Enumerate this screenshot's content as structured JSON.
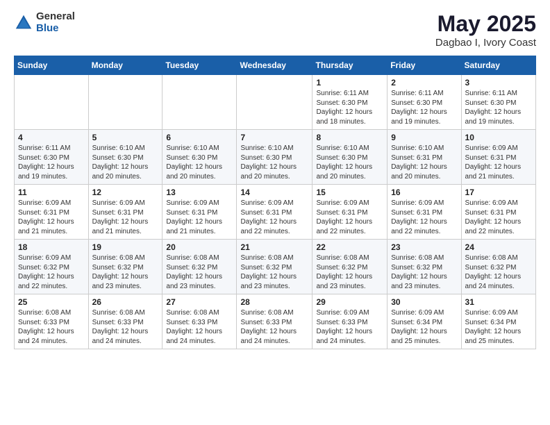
{
  "header": {
    "logo_general": "General",
    "logo_blue": "Blue",
    "month_title": "May 2025",
    "location": "Dagbao I, Ivory Coast"
  },
  "days_of_week": [
    "Sunday",
    "Monday",
    "Tuesday",
    "Wednesday",
    "Thursday",
    "Friday",
    "Saturday"
  ],
  "weeks": [
    [
      {
        "day": "",
        "info": ""
      },
      {
        "day": "",
        "info": ""
      },
      {
        "day": "",
        "info": ""
      },
      {
        "day": "",
        "info": ""
      },
      {
        "day": "1",
        "info": "Sunrise: 6:11 AM\nSunset: 6:30 PM\nDaylight: 12 hours\nand 18 minutes."
      },
      {
        "day": "2",
        "info": "Sunrise: 6:11 AM\nSunset: 6:30 PM\nDaylight: 12 hours\nand 19 minutes."
      },
      {
        "day": "3",
        "info": "Sunrise: 6:11 AM\nSunset: 6:30 PM\nDaylight: 12 hours\nand 19 minutes."
      }
    ],
    [
      {
        "day": "4",
        "info": "Sunrise: 6:11 AM\nSunset: 6:30 PM\nDaylight: 12 hours\nand 19 minutes."
      },
      {
        "day": "5",
        "info": "Sunrise: 6:10 AM\nSunset: 6:30 PM\nDaylight: 12 hours\nand 20 minutes."
      },
      {
        "day": "6",
        "info": "Sunrise: 6:10 AM\nSunset: 6:30 PM\nDaylight: 12 hours\nand 20 minutes."
      },
      {
        "day": "7",
        "info": "Sunrise: 6:10 AM\nSunset: 6:30 PM\nDaylight: 12 hours\nand 20 minutes."
      },
      {
        "day": "8",
        "info": "Sunrise: 6:10 AM\nSunset: 6:30 PM\nDaylight: 12 hours\nand 20 minutes."
      },
      {
        "day": "9",
        "info": "Sunrise: 6:10 AM\nSunset: 6:31 PM\nDaylight: 12 hours\nand 20 minutes."
      },
      {
        "day": "10",
        "info": "Sunrise: 6:09 AM\nSunset: 6:31 PM\nDaylight: 12 hours\nand 21 minutes."
      }
    ],
    [
      {
        "day": "11",
        "info": "Sunrise: 6:09 AM\nSunset: 6:31 PM\nDaylight: 12 hours\nand 21 minutes."
      },
      {
        "day": "12",
        "info": "Sunrise: 6:09 AM\nSunset: 6:31 PM\nDaylight: 12 hours\nand 21 minutes."
      },
      {
        "day": "13",
        "info": "Sunrise: 6:09 AM\nSunset: 6:31 PM\nDaylight: 12 hours\nand 21 minutes."
      },
      {
        "day": "14",
        "info": "Sunrise: 6:09 AM\nSunset: 6:31 PM\nDaylight: 12 hours\nand 22 minutes."
      },
      {
        "day": "15",
        "info": "Sunrise: 6:09 AM\nSunset: 6:31 PM\nDaylight: 12 hours\nand 22 minutes."
      },
      {
        "day": "16",
        "info": "Sunrise: 6:09 AM\nSunset: 6:31 PM\nDaylight: 12 hours\nand 22 minutes."
      },
      {
        "day": "17",
        "info": "Sunrise: 6:09 AM\nSunset: 6:31 PM\nDaylight: 12 hours\nand 22 minutes."
      }
    ],
    [
      {
        "day": "18",
        "info": "Sunrise: 6:09 AM\nSunset: 6:32 PM\nDaylight: 12 hours\nand 22 minutes."
      },
      {
        "day": "19",
        "info": "Sunrise: 6:08 AM\nSunset: 6:32 PM\nDaylight: 12 hours\nand 23 minutes."
      },
      {
        "day": "20",
        "info": "Sunrise: 6:08 AM\nSunset: 6:32 PM\nDaylight: 12 hours\nand 23 minutes."
      },
      {
        "day": "21",
        "info": "Sunrise: 6:08 AM\nSunset: 6:32 PM\nDaylight: 12 hours\nand 23 minutes."
      },
      {
        "day": "22",
        "info": "Sunrise: 6:08 AM\nSunset: 6:32 PM\nDaylight: 12 hours\nand 23 minutes."
      },
      {
        "day": "23",
        "info": "Sunrise: 6:08 AM\nSunset: 6:32 PM\nDaylight: 12 hours\nand 23 minutes."
      },
      {
        "day": "24",
        "info": "Sunrise: 6:08 AM\nSunset: 6:32 PM\nDaylight: 12 hours\nand 24 minutes."
      }
    ],
    [
      {
        "day": "25",
        "info": "Sunrise: 6:08 AM\nSunset: 6:33 PM\nDaylight: 12 hours\nand 24 minutes."
      },
      {
        "day": "26",
        "info": "Sunrise: 6:08 AM\nSunset: 6:33 PM\nDaylight: 12 hours\nand 24 minutes."
      },
      {
        "day": "27",
        "info": "Sunrise: 6:08 AM\nSunset: 6:33 PM\nDaylight: 12 hours\nand 24 minutes."
      },
      {
        "day": "28",
        "info": "Sunrise: 6:08 AM\nSunset: 6:33 PM\nDaylight: 12 hours\nand 24 minutes."
      },
      {
        "day": "29",
        "info": "Sunrise: 6:09 AM\nSunset: 6:33 PM\nDaylight: 12 hours\nand 24 minutes."
      },
      {
        "day": "30",
        "info": "Sunrise: 6:09 AM\nSunset: 6:34 PM\nDaylight: 12 hours\nand 25 minutes."
      },
      {
        "day": "31",
        "info": "Sunrise: 6:09 AM\nSunset: 6:34 PM\nDaylight: 12 hours\nand 25 minutes."
      }
    ]
  ]
}
